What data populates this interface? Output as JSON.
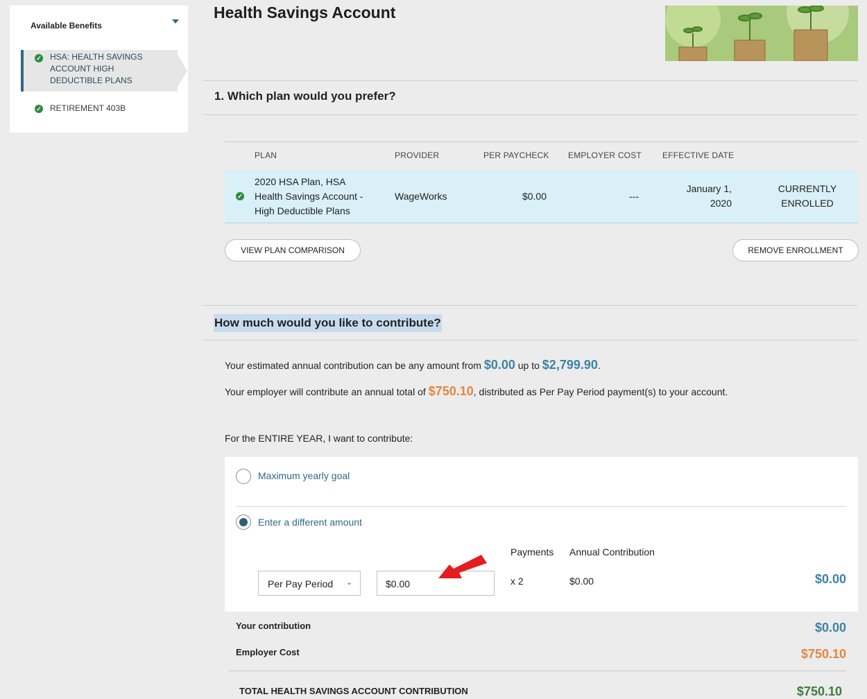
{
  "sidebar": {
    "title": "Available Benefits",
    "items": [
      {
        "line1": "HSA: HEALTH SAVINGS",
        "line2": "ACCOUNT HIGH",
        "line3": "DEDUCTIBLE PLANS"
      },
      {
        "line1": "RETIREMENT 403B"
      }
    ]
  },
  "page": {
    "title": "Health Savings Account"
  },
  "question1": {
    "text": "1. Which plan would you prefer?"
  },
  "plan_table": {
    "headers": [
      "PLAN",
      "PROVIDER",
      "PER PAYCHECK",
      "EMPLOYER COST",
      "EFFECTIVE DATE"
    ],
    "row": {
      "plan_line1": "2020 HSA Plan, HSA",
      "plan_line2": "Health Savings Account -",
      "plan_line3": "High Deductible Plans",
      "provider": "WageWorks",
      "per_paycheck": "$0.00",
      "employer_cost": "---",
      "date_line1": "January 1,",
      "date_line2": "2020",
      "status_line1": "CURRENTLY",
      "status_line2": "ENROLLED"
    }
  },
  "buttons": {
    "view_comparison": "VIEW PLAN COMPARISON",
    "remove_enrollment": "REMOVE ENROLLMENT"
  },
  "question2": {
    "text": "How much would you like to contribute?"
  },
  "info": {
    "line1_prefix": "Your estimated annual contribution can be any amount from",
    "line1_min": "$0.00",
    "line1_mid": "up to",
    "line1_max": "$2,799.90",
    "line1_end": ".",
    "line2_prefix": "Your employer will contribute an annual total of",
    "line2_amount": "$750.10",
    "line2_suffix": ", distributed as Per Pay Period payment(s) to your account."
  },
  "entire_year_label": "For the ENTIRE YEAR, I want to contribute:",
  "options": {
    "max_goal": "Maximum yearly goal",
    "different": "Enter a different amount",
    "selected": "different"
  },
  "contribution_form": {
    "payments_header": "Payments",
    "annual_header": "Annual Contribution",
    "period_select": "Per Pay Period",
    "amount_value": "$0.00",
    "payments_value": "x 2",
    "annual_value": "$0.00",
    "total_right": "$0.00"
  },
  "summary": {
    "your_label": "Your contribution",
    "your_value": "$0.00",
    "employer_label": "Employer Cost",
    "employer_value": "$750.10",
    "total_label": "TOTAL HEALTH SAVINGS ACCOUNT CONTRIBUTION",
    "total_value": "$750.10"
  },
  "colors": {
    "accent": "#2f6a84",
    "blue_amount": "#3d83a4",
    "orange_amount": "#e2863f",
    "green_total": "#3c7f3c",
    "enrolled_row": "#d9f0f8",
    "highlight": "#c9dcef"
  }
}
